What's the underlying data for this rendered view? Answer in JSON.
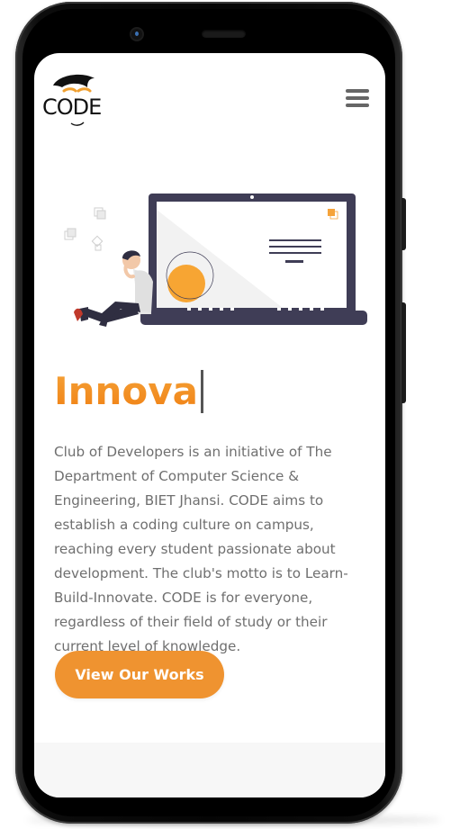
{
  "brand": {
    "logo_text": "CODE"
  },
  "header": {
    "menu_icon": "hamburger-menu-icon"
  },
  "hero": {
    "typed_text": "Innova",
    "illustration": "person-leaning-on-laptop-illustration",
    "description": "Club of Developers is an initiative of The Department of Computer Science & Engineering, BIET Jhansi. CODE aims to establish a coding culture on campus, reaching every student passionate about development. The club's motto is to Learn-Build-Innovate. CODE is for everyone, regardless of their field of study or their current level of knowledge.",
    "cta_label": "View Our Works"
  },
  "colors": {
    "accent": "#ef9330",
    "heading_gradient_start": "#f5a43a",
    "heading_gradient_end": "#f07f12",
    "body_text": "#6f6f6f",
    "illustration_dark": "#3f3d56",
    "illustration_light": "#f2f2f2"
  }
}
